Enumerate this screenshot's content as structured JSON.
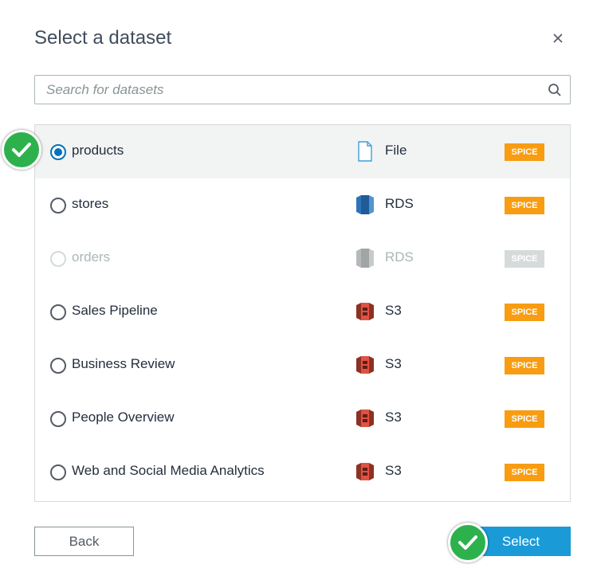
{
  "dialog": {
    "title": "Select a dataset",
    "close_icon": "close-icon"
  },
  "search": {
    "placeholder": "Search for datasets",
    "value": "",
    "icon": "search-icon"
  },
  "datasets": [
    {
      "name": "products",
      "source": "File",
      "source_icon": "file-icon",
      "badge": "SPICE",
      "selected": true,
      "disabled": false
    },
    {
      "name": "stores",
      "source": "RDS",
      "source_icon": "database-icon",
      "badge": "SPICE",
      "selected": false,
      "disabled": false
    },
    {
      "name": "orders",
      "source": "RDS",
      "source_icon": "database-icon",
      "badge": "SPICE",
      "selected": false,
      "disabled": true
    },
    {
      "name": "Sales Pipeline",
      "source": "S3",
      "source_icon": "s3-bucket-icon",
      "badge": "SPICE",
      "selected": false,
      "disabled": false
    },
    {
      "name": "Business Review",
      "source": "S3",
      "source_icon": "s3-bucket-icon",
      "badge": "SPICE",
      "selected": false,
      "disabled": false
    },
    {
      "name": "People Overview",
      "source": "S3",
      "source_icon": "s3-bucket-icon",
      "badge": "SPICE",
      "selected": false,
      "disabled": false
    },
    {
      "name": "Web and Social Media Analytics",
      "source": "S3",
      "source_icon": "s3-bucket-icon",
      "badge": "SPICE",
      "selected": false,
      "disabled": false
    }
  ],
  "footer": {
    "back_label": "Back",
    "select_label": "Select"
  },
  "colors": {
    "accent": "#0073bb",
    "primary_button": "#1a9bd7",
    "spice_badge": "#f89c12",
    "check_overlay": "#2db14d"
  }
}
